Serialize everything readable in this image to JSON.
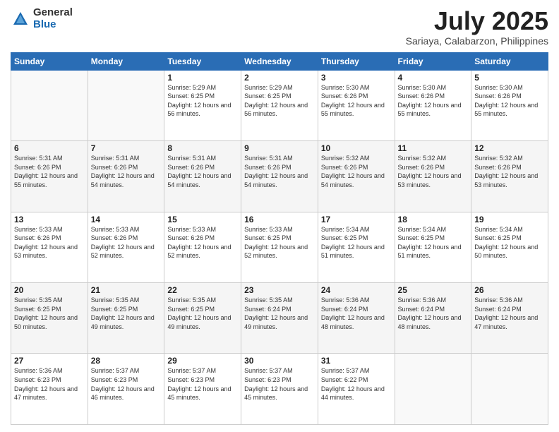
{
  "logo": {
    "general": "General",
    "blue": "Blue"
  },
  "title": {
    "month_year": "July 2025",
    "location": "Sariaya, Calabarzon, Philippines"
  },
  "weekdays": [
    "Sunday",
    "Monday",
    "Tuesday",
    "Wednesday",
    "Thursday",
    "Friday",
    "Saturday"
  ],
  "weeks": [
    [
      {
        "day": "",
        "sunrise": "",
        "sunset": "",
        "daylight": ""
      },
      {
        "day": "",
        "sunrise": "",
        "sunset": "",
        "daylight": ""
      },
      {
        "day": "1",
        "sunrise": "Sunrise: 5:29 AM",
        "sunset": "Sunset: 6:25 PM",
        "daylight": "Daylight: 12 hours and 56 minutes."
      },
      {
        "day": "2",
        "sunrise": "Sunrise: 5:29 AM",
        "sunset": "Sunset: 6:25 PM",
        "daylight": "Daylight: 12 hours and 56 minutes."
      },
      {
        "day": "3",
        "sunrise": "Sunrise: 5:30 AM",
        "sunset": "Sunset: 6:26 PM",
        "daylight": "Daylight: 12 hours and 55 minutes."
      },
      {
        "day": "4",
        "sunrise": "Sunrise: 5:30 AM",
        "sunset": "Sunset: 6:26 PM",
        "daylight": "Daylight: 12 hours and 55 minutes."
      },
      {
        "day": "5",
        "sunrise": "Sunrise: 5:30 AM",
        "sunset": "Sunset: 6:26 PM",
        "daylight": "Daylight: 12 hours and 55 minutes."
      }
    ],
    [
      {
        "day": "6",
        "sunrise": "Sunrise: 5:31 AM",
        "sunset": "Sunset: 6:26 PM",
        "daylight": "Daylight: 12 hours and 55 minutes."
      },
      {
        "day": "7",
        "sunrise": "Sunrise: 5:31 AM",
        "sunset": "Sunset: 6:26 PM",
        "daylight": "Daylight: 12 hours and 54 minutes."
      },
      {
        "day": "8",
        "sunrise": "Sunrise: 5:31 AM",
        "sunset": "Sunset: 6:26 PM",
        "daylight": "Daylight: 12 hours and 54 minutes."
      },
      {
        "day": "9",
        "sunrise": "Sunrise: 5:31 AM",
        "sunset": "Sunset: 6:26 PM",
        "daylight": "Daylight: 12 hours and 54 minutes."
      },
      {
        "day": "10",
        "sunrise": "Sunrise: 5:32 AM",
        "sunset": "Sunset: 6:26 PM",
        "daylight": "Daylight: 12 hours and 54 minutes."
      },
      {
        "day": "11",
        "sunrise": "Sunrise: 5:32 AM",
        "sunset": "Sunset: 6:26 PM",
        "daylight": "Daylight: 12 hours and 53 minutes."
      },
      {
        "day": "12",
        "sunrise": "Sunrise: 5:32 AM",
        "sunset": "Sunset: 6:26 PM",
        "daylight": "Daylight: 12 hours and 53 minutes."
      }
    ],
    [
      {
        "day": "13",
        "sunrise": "Sunrise: 5:33 AM",
        "sunset": "Sunset: 6:26 PM",
        "daylight": "Daylight: 12 hours and 53 minutes."
      },
      {
        "day": "14",
        "sunrise": "Sunrise: 5:33 AM",
        "sunset": "Sunset: 6:26 PM",
        "daylight": "Daylight: 12 hours and 52 minutes."
      },
      {
        "day": "15",
        "sunrise": "Sunrise: 5:33 AM",
        "sunset": "Sunset: 6:26 PM",
        "daylight": "Daylight: 12 hours and 52 minutes."
      },
      {
        "day": "16",
        "sunrise": "Sunrise: 5:33 AM",
        "sunset": "Sunset: 6:25 PM",
        "daylight": "Daylight: 12 hours and 52 minutes."
      },
      {
        "day": "17",
        "sunrise": "Sunrise: 5:34 AM",
        "sunset": "Sunset: 6:25 PM",
        "daylight": "Daylight: 12 hours and 51 minutes."
      },
      {
        "day": "18",
        "sunrise": "Sunrise: 5:34 AM",
        "sunset": "Sunset: 6:25 PM",
        "daylight": "Daylight: 12 hours and 51 minutes."
      },
      {
        "day": "19",
        "sunrise": "Sunrise: 5:34 AM",
        "sunset": "Sunset: 6:25 PM",
        "daylight": "Daylight: 12 hours and 50 minutes."
      }
    ],
    [
      {
        "day": "20",
        "sunrise": "Sunrise: 5:35 AM",
        "sunset": "Sunset: 6:25 PM",
        "daylight": "Daylight: 12 hours and 50 minutes."
      },
      {
        "day": "21",
        "sunrise": "Sunrise: 5:35 AM",
        "sunset": "Sunset: 6:25 PM",
        "daylight": "Daylight: 12 hours and 49 minutes."
      },
      {
        "day": "22",
        "sunrise": "Sunrise: 5:35 AM",
        "sunset": "Sunset: 6:25 PM",
        "daylight": "Daylight: 12 hours and 49 minutes."
      },
      {
        "day": "23",
        "sunrise": "Sunrise: 5:35 AM",
        "sunset": "Sunset: 6:24 PM",
        "daylight": "Daylight: 12 hours and 49 minutes."
      },
      {
        "day": "24",
        "sunrise": "Sunrise: 5:36 AM",
        "sunset": "Sunset: 6:24 PM",
        "daylight": "Daylight: 12 hours and 48 minutes."
      },
      {
        "day": "25",
        "sunrise": "Sunrise: 5:36 AM",
        "sunset": "Sunset: 6:24 PM",
        "daylight": "Daylight: 12 hours and 48 minutes."
      },
      {
        "day": "26",
        "sunrise": "Sunrise: 5:36 AM",
        "sunset": "Sunset: 6:24 PM",
        "daylight": "Daylight: 12 hours and 47 minutes."
      }
    ],
    [
      {
        "day": "27",
        "sunrise": "Sunrise: 5:36 AM",
        "sunset": "Sunset: 6:23 PM",
        "daylight": "Daylight: 12 hours and 47 minutes."
      },
      {
        "day": "28",
        "sunrise": "Sunrise: 5:37 AM",
        "sunset": "Sunset: 6:23 PM",
        "daylight": "Daylight: 12 hours and 46 minutes."
      },
      {
        "day": "29",
        "sunrise": "Sunrise: 5:37 AM",
        "sunset": "Sunset: 6:23 PM",
        "daylight": "Daylight: 12 hours and 45 minutes."
      },
      {
        "day": "30",
        "sunrise": "Sunrise: 5:37 AM",
        "sunset": "Sunset: 6:23 PM",
        "daylight": "Daylight: 12 hours and 45 minutes."
      },
      {
        "day": "31",
        "sunrise": "Sunrise: 5:37 AM",
        "sunset": "Sunset: 6:22 PM",
        "daylight": "Daylight: 12 hours and 44 minutes."
      },
      {
        "day": "",
        "sunrise": "",
        "sunset": "",
        "daylight": ""
      },
      {
        "day": "",
        "sunrise": "",
        "sunset": "",
        "daylight": ""
      }
    ]
  ]
}
